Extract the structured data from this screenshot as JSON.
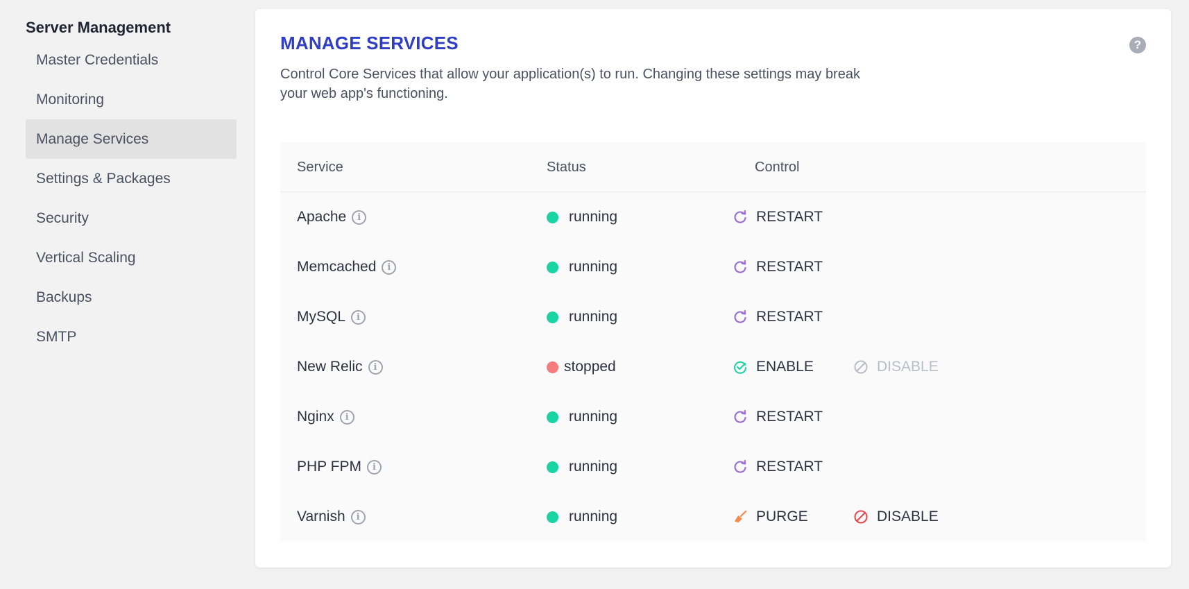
{
  "sidebar": {
    "title": "Server Management",
    "items": [
      {
        "label": "Master Credentials"
      },
      {
        "label": "Monitoring"
      },
      {
        "label": "Manage Services"
      },
      {
        "label": "Settings & Packages"
      },
      {
        "label": "Security"
      },
      {
        "label": "Vertical Scaling"
      },
      {
        "label": "Backups"
      },
      {
        "label": "SMTP"
      }
    ],
    "active_index": 2
  },
  "main": {
    "title": "MANAGE SERVICES",
    "help_icon": "?",
    "description": "Control Core Services that allow your application(s) to run. Changing these settings may break your web app's functioning.",
    "table": {
      "headers": {
        "service": "Service",
        "status": "Status",
        "control": "Control"
      },
      "rows": [
        {
          "service": "Apache",
          "status": "running",
          "controls": [
            {
              "label": "RESTART",
              "icon": "restart-icon",
              "enabled": true
            }
          ]
        },
        {
          "service": "Memcached",
          "status": "running",
          "controls": [
            {
              "label": "RESTART",
              "icon": "restart-icon",
              "enabled": true
            }
          ]
        },
        {
          "service": "MySQL",
          "status": "running",
          "controls": [
            {
              "label": "RESTART",
              "icon": "restart-icon",
              "enabled": true
            }
          ]
        },
        {
          "service": "New Relic",
          "status": "stopped",
          "controls": [
            {
              "label": "ENABLE",
              "icon": "check-circle-icon",
              "enabled": true
            },
            {
              "label": "DISABLE",
              "icon": "block-icon",
              "enabled": false
            }
          ]
        },
        {
          "service": "Nginx",
          "status": "running",
          "controls": [
            {
              "label": "RESTART",
              "icon": "restart-icon",
              "enabled": true
            }
          ]
        },
        {
          "service": "PHP FPM",
          "status": "running",
          "controls": [
            {
              "label": "RESTART",
              "icon": "restart-icon",
              "enabled": true
            }
          ]
        },
        {
          "service": "Varnish",
          "status": "running",
          "controls": [
            {
              "label": "PURGE",
              "icon": "broom-icon",
              "enabled": true
            },
            {
              "label": "DISABLE",
              "icon": "block-icon",
              "enabled": true
            }
          ]
        }
      ]
    }
  },
  "colors": {
    "title": "#2f3ec4",
    "running": "#19d3a2",
    "stopped": "#f47c7c",
    "restart_icon": "#9b6fd6",
    "enable_icon": "#19d3a2",
    "purge_icon": "#f58a4b",
    "disable_active": "#e5484d",
    "disable_inactive": "#b9bdc6"
  }
}
